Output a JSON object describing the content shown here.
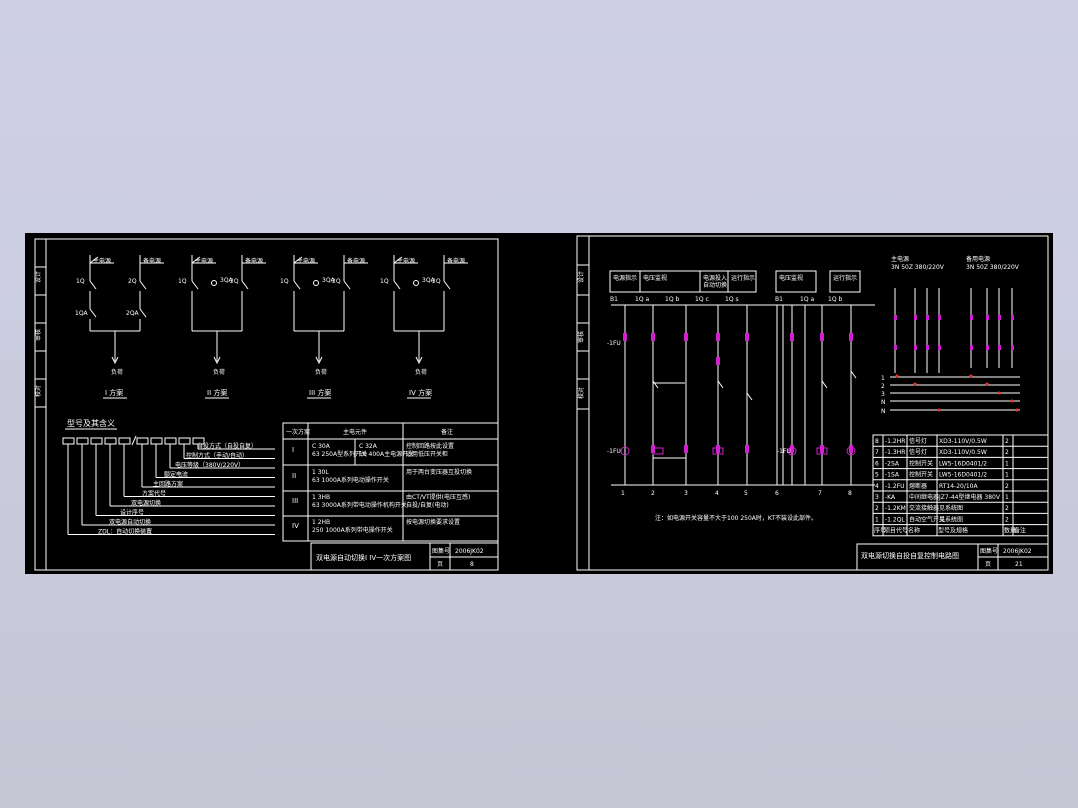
{
  "colors": {
    "background": "#cfd0e6",
    "canvas": "#000000",
    "line": "#ffffff",
    "contact": "#d020d0",
    "dot": "#ff3030"
  },
  "left_sheet": {
    "side_labels": [
      "设计",
      "审核",
      "校对"
    ],
    "sources": [
      "主电源",
      "备电源"
    ],
    "switch_labels": [
      "1Q",
      "2Q",
      "1QA",
      "2QA",
      "3QA"
    ],
    "load": "负荷",
    "schemes": [
      "I 方案",
      "II 方案",
      "III 方案",
      "IV 方案"
    ],
    "code_title": "型号及其含义",
    "code_items": [
      "自投方式（自投自复）",
      "控制方式（手动/自动）",
      "电压等级（380V/220V）",
      "额定电流",
      "主回路方案",
      "方案代号",
      "双电源切换",
      "设计序号",
      "双电源自动切换",
      "ZDL：自动切换装置"
    ],
    "table": {
      "headers": [
        "一次方案",
        "主电元件",
        "备注"
      ],
      "rows": [
        [
          "I",
          "C 30A\n63 250A型系列开关",
          "C 32A\n10 400A主电源开关",
          "控制回路按此设置\n适用低压开关柜"
        ],
        [
          "II",
          "1 30L\n63 1000A系列电动操作开关",
          "",
          "用于两台变压器互投切换"
        ],
        [
          "III",
          "1 3HB\n63 3000A系列带电动操作机构开关",
          "",
          "由CT/VT提供(电压互感)\n自投/自复(电动)"
        ],
        [
          "IV",
          "1 2HB\n250 1000A系列带电操作开关",
          "",
          "按电源切换要求设置"
        ]
      ]
    },
    "title_block": {
      "title": "双电源自动切换I IV一次方案图",
      "label_a": "图集号",
      "value_a": "2006JK02",
      "label_b": "页",
      "value_b": "8"
    }
  },
  "right_sheet": {
    "side_labels": [
      "设计",
      "审核",
      "校对"
    ],
    "header_cells": [
      "电源指示",
      "电压监视",
      "电源投入\n自动切换",
      "运行指示",
      "电压监视",
      "运行指示"
    ],
    "bus_labels": [
      "B1",
      "1Q a",
      "1Q b",
      "1Q c",
      "1Q s"
    ],
    "note": "注：如电源开关容量不大于100 250A时，KT不装设此部件。",
    "supply_labels": [
      "主电源\n3N 50Z 380/220V",
      "备用电源\n3N 50Z 380/220V"
    ],
    "parts": {
      "headers": [
        "序号",
        "项目代号",
        "名称",
        "型号及规格",
        "数量",
        "备注"
      ],
      "rows": [
        [
          "8",
          "-1.2HR",
          "信号灯",
          "XD3-110V/0.5W",
          "2",
          ""
        ],
        [
          "7",
          "-1.3HR",
          "信号灯",
          "XD3-110V/0.5W",
          "2",
          ""
        ],
        [
          "6",
          "-2SA",
          "控制开关",
          "LW5-16D0401/2",
          "1",
          ""
        ],
        [
          "5",
          "-1SA",
          "控制开关",
          "LW5-16D0401/2",
          "1",
          ""
        ],
        [
          "4",
          "-1.2FU",
          "熔断器",
          "RT14-20/10A",
          "2",
          ""
        ],
        [
          "3",
          "-KA",
          "中间继电器",
          "JZ7-44型继电器 380V",
          "1",
          ""
        ],
        [
          "2",
          "-1.2KM",
          "交流接触器",
          "见系统图",
          "2",
          ""
        ],
        [
          "1",
          "-1.2QL",
          "自动空气开关",
          "见系统图",
          "2",
          ""
        ]
      ]
    },
    "title_block": {
      "title": "双电源切换自投自复控制电路图",
      "label_a": "图集号",
      "value_a": "2006JK02",
      "label_b": "页",
      "value_b": "21"
    },
    "numbers": [
      "1",
      "2",
      "3",
      "4",
      "5",
      "6",
      "7",
      "8"
    ]
  }
}
